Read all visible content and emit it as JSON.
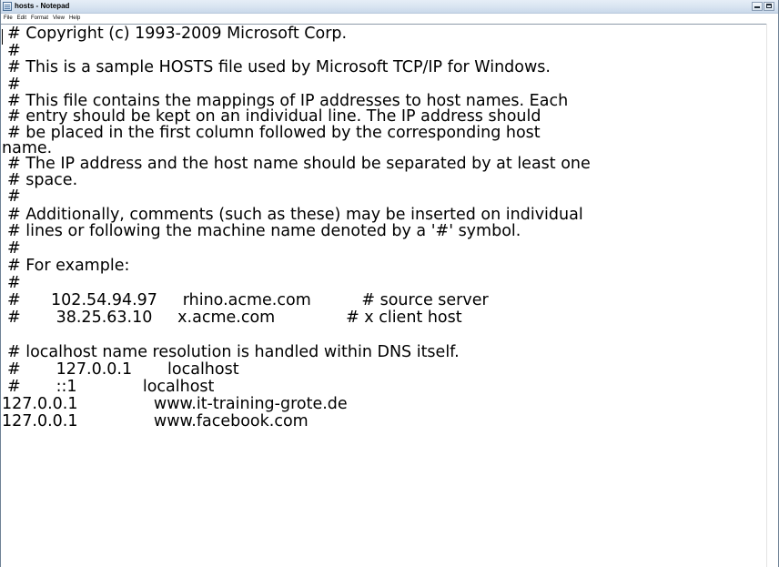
{
  "window": {
    "title": "hosts - Notepad"
  },
  "menu": {
    "file": "File",
    "edit": "Edit",
    "format": "Format",
    "view": "View",
    "help": "Help"
  },
  "document": {
    "lines": [
      "# Copyright (c) 1993-2009 Microsoft Corp.",
      "#",
      "# This is a sample HOSTS file used by Microsoft TCP/IP for Windows.",
      "#",
      "# This file contains the mappings of IP addresses to host names. Each",
      "# entry should be kept on an individual line. The IP address should",
      "# be placed in the first column followed by the corresponding host",
      "name.",
      "# The IP address and the host name should be separated by at least one",
      "# space.",
      "#",
      "# Additionally, comments (such as these) may be inserted on individual",
      "# lines or following the machine name denoted by a '#' symbol.",
      "#",
      "# For example:",
      "#",
      "#      102.54.94.97     rhino.acme.com          # source server",
      "#       38.25.63.10     x.acme.com              # x client host",
      "",
      "# localhost name resolution is handled within DNS itself.",
      "#       127.0.0.1       localhost",
      "#       ::1             localhost",
      "127.0.0.1               www.it-training-grote.de",
      "127.0.0.1               www.facebook.com"
    ]
  }
}
